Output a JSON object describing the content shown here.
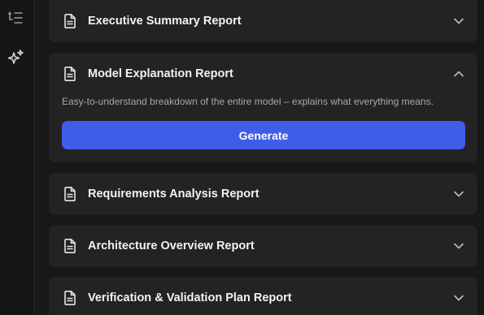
{
  "sidebar": {
    "items": [
      {
        "icon": "outline-list-icon"
      },
      {
        "icon": "sparkle-ai-icon"
      }
    ]
  },
  "reports": [
    {
      "title": "Executive Summary Report",
      "expanded": false
    },
    {
      "title": "Model Explanation Report",
      "expanded": true,
      "description": "Easy-to-understand breakdown of the entire model – explains what everything means.",
      "button_label": "Generate"
    },
    {
      "title": "Requirements Analysis Report",
      "expanded": false
    },
    {
      "title": "Architecture Overview Report",
      "expanded": false
    },
    {
      "title": "Verification & Validation Plan Report",
      "expanded": false
    }
  ],
  "colors": {
    "accent": "#3f5ee8",
    "card": "#232323",
    "background": "#181818"
  }
}
